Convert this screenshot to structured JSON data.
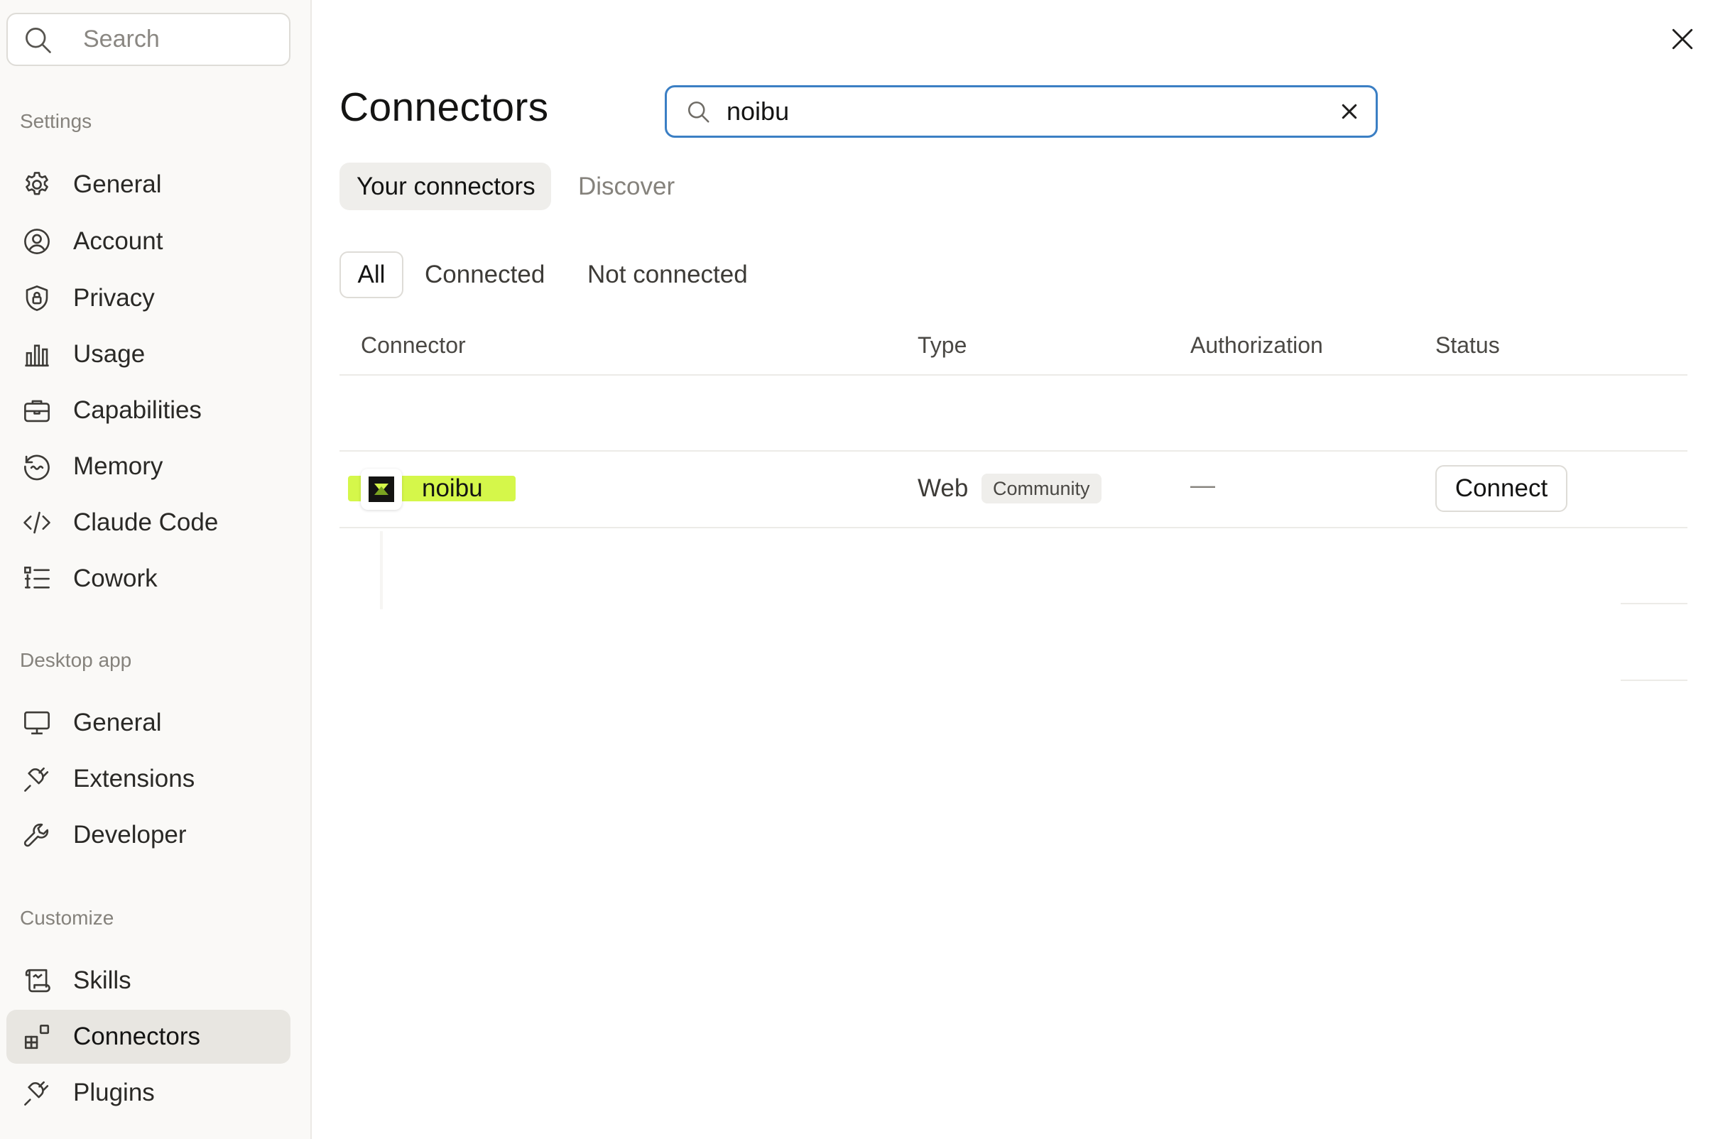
{
  "sidebar": {
    "search": {
      "placeholder": "Search",
      "icon": "search-icon"
    },
    "sections": [
      {
        "label": "Settings",
        "items": [
          {
            "label": "General",
            "icon": "gear-icon"
          },
          {
            "label": "Account",
            "icon": "user-circle-icon"
          },
          {
            "label": "Privacy",
            "icon": "shield-lock-icon"
          },
          {
            "label": "Usage",
            "icon": "bar-chart-icon"
          },
          {
            "label": "Capabilities",
            "icon": "briefcase-icon"
          },
          {
            "label": "Memory",
            "icon": "memory-icon"
          },
          {
            "label": "Claude Code",
            "icon": "code-icon"
          },
          {
            "label": "Cowork",
            "icon": "checklist-icon"
          }
        ]
      },
      {
        "label": "Desktop app",
        "items": [
          {
            "label": "General",
            "icon": "monitor-icon"
          },
          {
            "label": "Extensions",
            "icon": "plug-icon"
          },
          {
            "label": "Developer",
            "icon": "wrench-icon"
          }
        ]
      },
      {
        "label": "Customize",
        "items": [
          {
            "label": "Skills",
            "icon": "scroll-icon"
          },
          {
            "label": "Connectors",
            "icon": "connectors-icon",
            "active": true
          },
          {
            "label": "Plugins",
            "icon": "plug-icon"
          }
        ]
      }
    ]
  },
  "main": {
    "title": "Connectors",
    "search": {
      "value": "noibu"
    },
    "tabs": [
      {
        "label": "Your connectors",
        "active": true
      },
      {
        "label": "Discover",
        "active": false
      }
    ],
    "filters": [
      {
        "label": "All",
        "active": true
      },
      {
        "label": "Connected",
        "active": false
      },
      {
        "label": "Not connected",
        "active": false
      }
    ],
    "table": {
      "headers": [
        "Connector",
        "Type",
        "Authorization",
        "Status"
      ],
      "rows": [
        {
          "name": "noibu",
          "type": "Web",
          "badge": "Community",
          "authorization": "—",
          "action": "Connect"
        }
      ]
    }
  },
  "colors": {
    "accent_focus": "#3b7fc4",
    "highlight": "#d5f74a",
    "sidebar_bg": "#faf9f7",
    "active_item_bg": "#e8e6e1"
  }
}
